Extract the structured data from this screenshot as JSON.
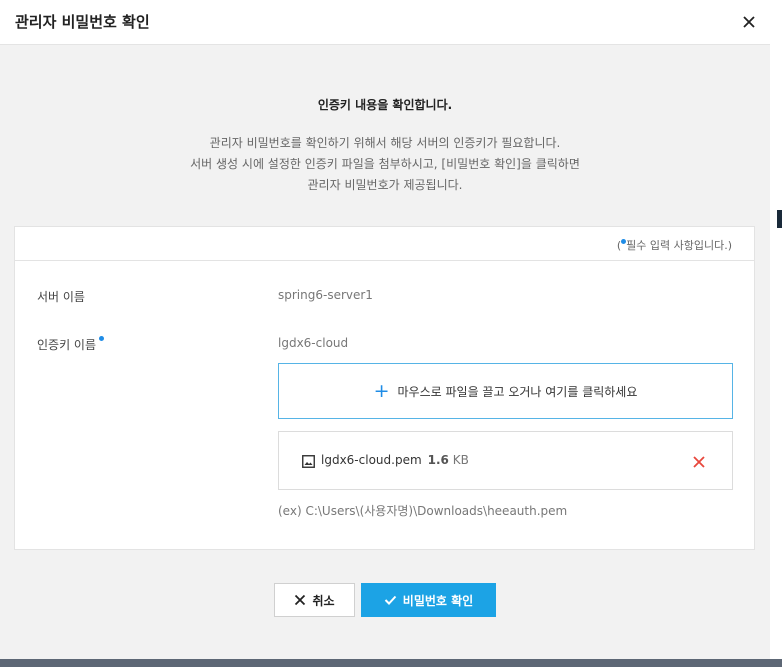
{
  "dialog": {
    "title": "관리자 비밀번호 확인",
    "close_icon": "close-icon"
  },
  "intro": {
    "heading": "인증키 내용을 확인합니다.",
    "lines": [
      "관리자 비밀번호를 확인하기 위해서 해당 서버의 인증키가 필요합니다.",
      "서버 생성 시에 설정한 인증키 파일을 첨부하시고, [비밀번호 확인]을 클릭하면",
      "관리자 비밀번호가 제공됩니다."
    ]
  },
  "form": {
    "required_note_open": "(",
    "required_note": "필수 입력 사항입니다.)",
    "server_name_label": "서버 이름",
    "server_name_value": "spring6-server1",
    "auth_key_label": "인증키 이름",
    "auth_key_value": "lgdx6-cloud",
    "dropzone_text": "마우스로 파일을 끌고 오거나 여기를 클릭하세요",
    "file": {
      "name": "lgdx6-cloud.pem",
      "size": "1.6",
      "unit": "KB"
    },
    "example_path": "(ex) C:\\Users\\(사용자명)\\Downloads\\heeauth.pem"
  },
  "buttons": {
    "cancel_label": "취소",
    "confirm_label": "비밀번호 확인"
  },
  "colors": {
    "accent": "#1ca3e5",
    "required_dot": "#1f8ce6",
    "remove": "#e8473c"
  }
}
